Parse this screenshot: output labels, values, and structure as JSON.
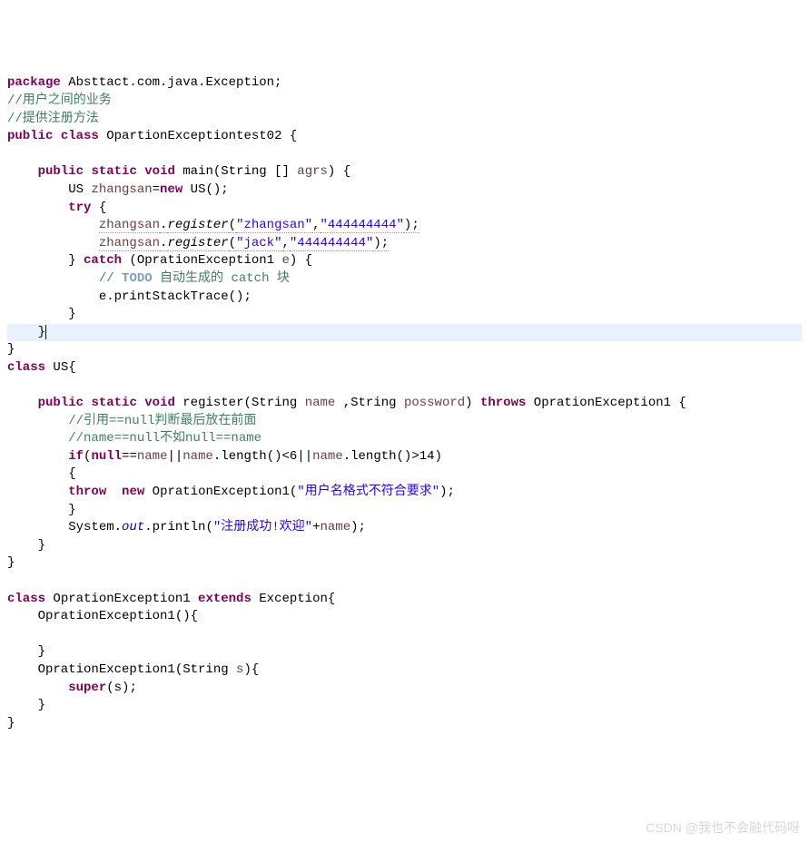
{
  "code": {
    "package_kw": "package",
    "package_val": " Absttact.com.java.Exception;",
    "comment1": "//用户之间的业务",
    "comment2": "//提供注册方法",
    "public_kw": "public",
    "class_kw": "class",
    "class_name": " OpartionExceptiontest02 {",
    "static_kw": "static",
    "void_kw": "void",
    "main_name": " main(String [] ",
    "agrs": "agrs",
    "main_end": ") {",
    "us_decl1": "        US ",
    "zhangsan": "zhangsan",
    "us_decl2": "=",
    "new_kw": "new",
    "us_decl3": " US();",
    "try_kw": "try",
    "try_brace": " {",
    "reg_call1a": "            ",
    "reg_zhangsan": "zhangsan",
    "reg_dot": ".",
    "register_m": "register",
    "reg_p1": "(",
    "str_zhangsan": "\"zhangsan\"",
    "comma": ",",
    "str_pwd1": "\"444444444\"",
    "reg_p2": ");",
    "str_jack": "\"jack\"",
    "str_pwd2": "\"444444444\"",
    "catch_kw": "catch",
    "catch_arg": " (OprationException1 ",
    "e_var": "e",
    "catch_brace": ") {",
    "todo_indent": "            ",
    "todo_slash": "// ",
    "todo_kw": "TODO",
    "todo_txt": " 自动生成的 catch 块",
    "print_stack": "            e.printStackTrace();",
    "close_brace1": "        }",
    "close_brace2": "    }",
    "close_brace3": "}",
    "us_class": " US{",
    "reg_sig1": " register(String ",
    "name_p": "name",
    "reg_sig2": " ,String ",
    "possword_p": "possword",
    "reg_sig3": ") ",
    "throws_kw": "throws",
    "reg_sig4": " OprationException1 {",
    "comment3": "        //引用==null判断最后放在前面",
    "comment4": "        //name==null不如null==name",
    "if_kw": "if",
    "if_cond1": "(",
    "null_kw": "null",
    "if_cond2": "==",
    "if_name": "name",
    "if_cond3": "||",
    "if_cond4": ".length()<6||",
    "if_cond5": ".length()>14)",
    "open_brace": "        {",
    "throw_kw": "throw",
    "throw_sp": "  ",
    "throw_arg": " OprationException1(",
    "str_err": "\"用户名格式不符合要求\"",
    "throw_end": ");",
    "sys": "        System.",
    "out": "out",
    "println": ".println(",
    "str_success": "\"注册成功!欢迎\"",
    "plus_name": "+",
    "println_end": ");",
    "opr_class": " OprationException1 ",
    "extends_kw": "extends",
    "exc_name": " Exception{",
    "ctor1": "    OprationException1(){",
    "ctor2": "    OprationException1(String ",
    "s_param": "s",
    "ctor2_end": "){",
    "super_kw": "super",
    "super_arg": "(s);"
  },
  "watermark": "CSDN @我也不会融代码呀"
}
